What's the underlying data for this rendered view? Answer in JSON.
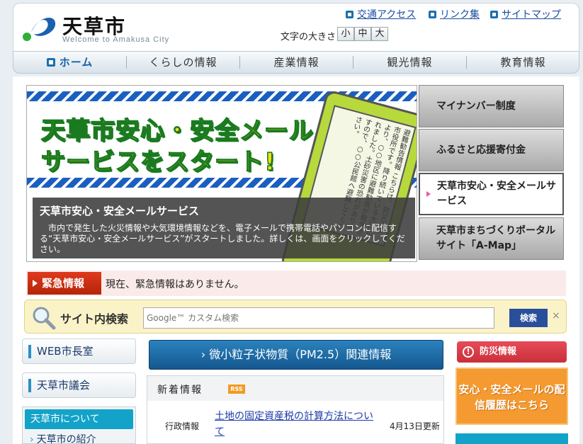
{
  "header": {
    "title": "天草市",
    "subtitle": "Welcome to Amakusa City",
    "links": [
      "交通アクセス",
      "リンク集",
      "サイトマップ"
    ],
    "fontsize_label": "文字の大きさ",
    "fontsize_options": [
      "小",
      "中",
      "大"
    ]
  },
  "nav": [
    "ホーム",
    "くらしの情報",
    "産業情報",
    "観光情報",
    "教育情報"
  ],
  "banner": {
    "headline1": "天草市安心・安全メール",
    "headline2": "サービスをスタート!",
    "phone_text": "避難勧告情報 こちらは、防災天草市役所です。降り続いている大雨により、○○地区に避難勧告が発令されました。土砂災害の恐れがありますので、○○公民館へ避難してください。",
    "caption_title": "天草市安心・安全メールサービス",
    "caption_body": "市内で発生した火災情報や大気環境情報などを、電子メールで携帯電話やパソコンに配信する“天草市安心・安全メールサービス”がスタートしました。詳しくは、画面をクリックしてください。",
    "tabs": [
      "マイナンバー制度",
      "ふるさと応援寄付金",
      "天草市安心・安全メールサービス",
      "天草市まちづくりポータルサイト「A-Map」"
    ]
  },
  "emergency": {
    "label": "緊急情報",
    "text": "現在、緊急情報はありません。"
  },
  "search": {
    "label": "サイト内検索",
    "placeholder": "Google™ カスタム検索",
    "button": "検索",
    "clear": "×"
  },
  "left": {
    "items": [
      "WEB市長室",
      "天草市議会"
    ],
    "about_head": "天草市について",
    "about_item": "天草市の紹介"
  },
  "center": {
    "pm_banner": "微小粒子状物質（PM2.5）関連情報",
    "news_title": "新着情報",
    "rss": "RSS",
    "news": {
      "category": "行政情報",
      "link": "土地の固定資産税の計算方法について",
      "date": "4月13日更新"
    }
  },
  "right": {
    "bousai": "防災情報",
    "mail_history": "安心・安全メールの配信履歴はこちら"
  },
  "colors": {
    "accent_blue": "#1a6fb0",
    "emergency_red": "#c9301a",
    "mail_orange": "#f49a30"
  }
}
